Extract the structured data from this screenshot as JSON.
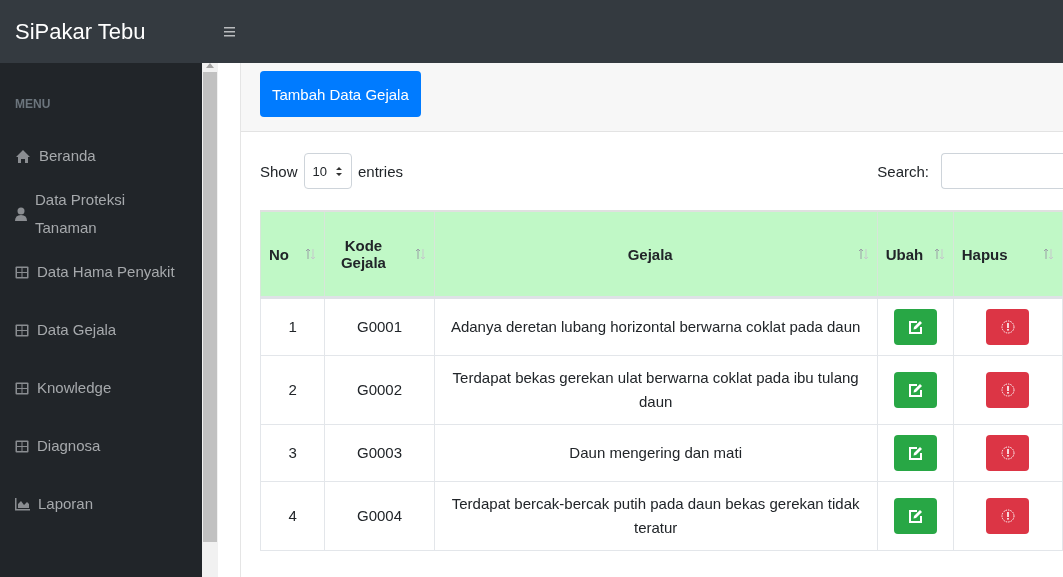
{
  "brand": "SiPakar Tebu",
  "sidebar": {
    "heading": "MENU",
    "items": [
      {
        "label": "Beranda",
        "kind": "home"
      },
      {
        "label": "Data Proteksi Tanaman",
        "kind": "user"
      },
      {
        "label": "Data Hama Penyakit",
        "kind": "table"
      },
      {
        "label": "Data Gejala",
        "kind": "table"
      },
      {
        "label": "Knowledge",
        "kind": "table"
      },
      {
        "label": "Diagnosa",
        "kind": "table"
      },
      {
        "label": "Laporan",
        "kind": "chart"
      }
    ]
  },
  "add_button": "Tambah Data Gejala",
  "length_menu": {
    "before": "Show",
    "value": "10",
    "after": "entries"
  },
  "search": {
    "label": "Search:"
  },
  "table": {
    "columns": [
      "No",
      "Kode Gejala",
      "Gejala",
      "Ubah",
      "Hapus"
    ],
    "rows": [
      {
        "no": "1",
        "code": "G0001",
        "symptom": "Adanya deretan lubang horizontal berwarna coklat pada daun"
      },
      {
        "no": "2",
        "code": "G0002",
        "symptom": "Terdapat bekas gerekan ulat berwarna coklat pada ibu tulang daun"
      },
      {
        "no": "3",
        "code": "G0003",
        "symptom": "Daun mengering dan mati"
      },
      {
        "no": "4",
        "code": "G0004",
        "symptom": "Terdapat bercak-bercak putih pada daun bekas gerekan tidak teratur"
      }
    ]
  }
}
